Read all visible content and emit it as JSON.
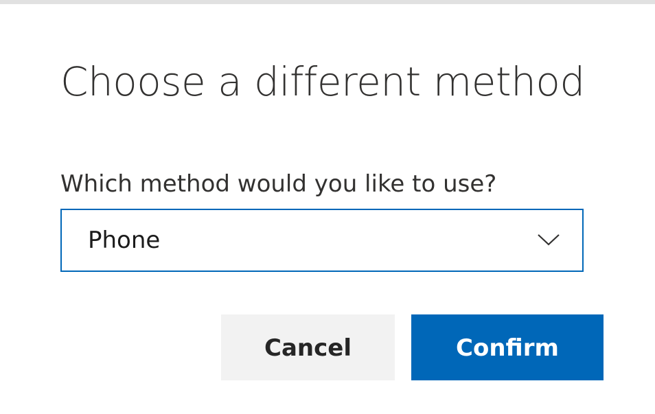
{
  "dialog": {
    "title": "Choose a different method",
    "prompt": "Which method would you like to use?",
    "method_select": {
      "selected_value": "Phone",
      "icon": "chevron-down-icon"
    },
    "buttons": {
      "cancel_label": "Cancel",
      "confirm_label": "Confirm"
    }
  },
  "colors": {
    "accent": "#0067b8",
    "cancel_bg": "#f2f2f2",
    "text": "#323130",
    "top_border": "#e1e1e1"
  }
}
